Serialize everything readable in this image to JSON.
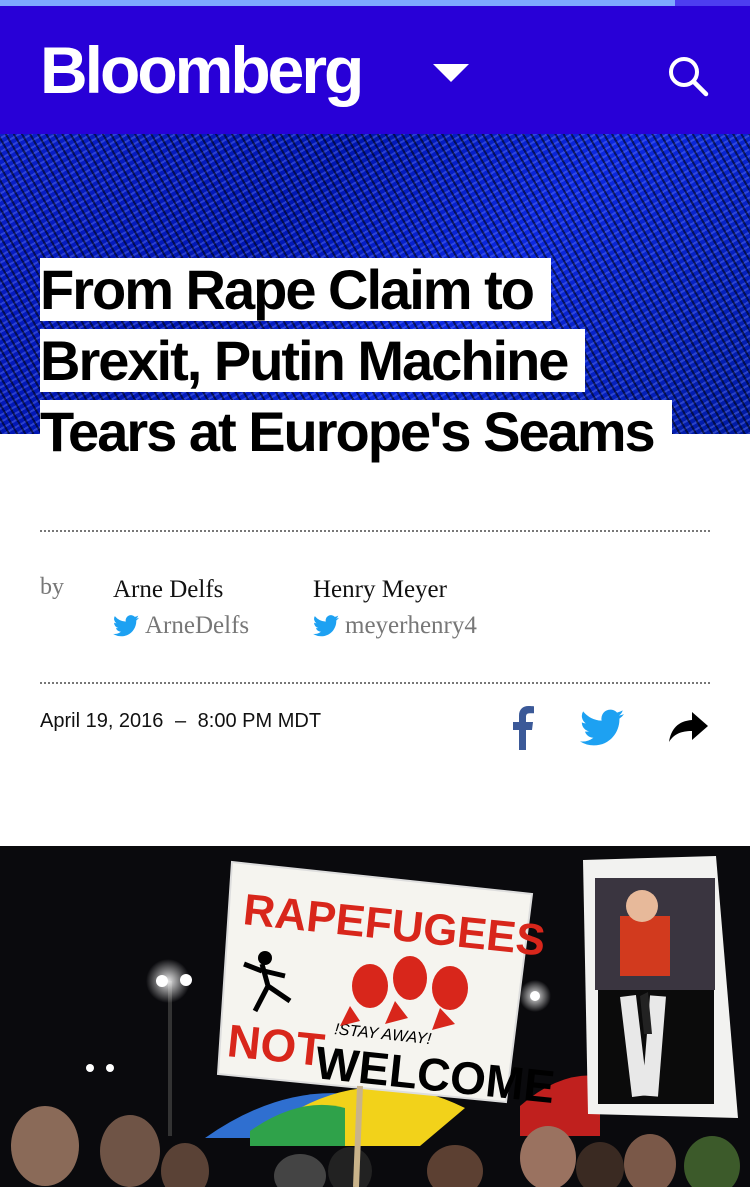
{
  "progress": {
    "fraction": 0.9
  },
  "header": {
    "brand": "Bloomberg",
    "brand_color": "#2800d7",
    "menu_icon": "caret-down-icon",
    "search_icon": "search-icon"
  },
  "article": {
    "headline_lines": [
      "From Rape Claim to",
      "Brexit, Putin Machine",
      "Tears at Europe's Seams"
    ],
    "byline_prefix": "by",
    "authors": [
      {
        "name": "Arne Delfs",
        "handle": "ArneDelfs"
      },
      {
        "name": "Henry Meyer",
        "handle": "meyerhenry4"
      }
    ],
    "date": "April 19, 2016",
    "separator": "–",
    "time": "8:00 PM MDT",
    "share": {
      "facebook_icon": "facebook-icon",
      "twitter_icon": "twitter-icon",
      "share_icon": "share-arrow-icon"
    }
  },
  "photo": {
    "sign_lines": [
      "RAPEFUGEES",
      "!STAY AWAY!",
      "NOT",
      "WELCOME"
    ]
  },
  "colors": {
    "twitter": "#1da1f2",
    "facebook": "#3b5998"
  }
}
